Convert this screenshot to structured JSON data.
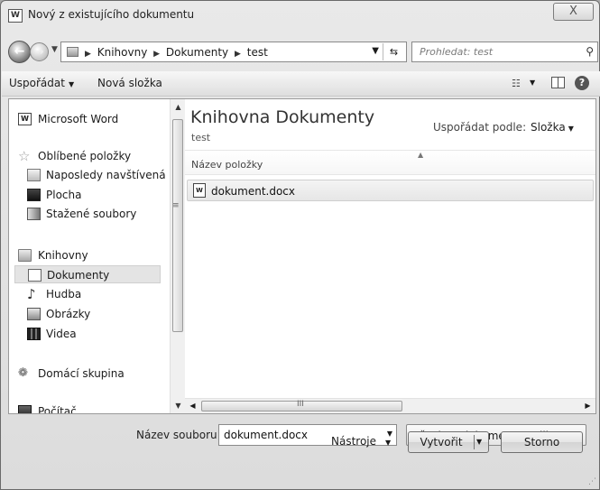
{
  "window": {
    "title": "Nový z existujícího dokumentu",
    "close_label": "X",
    "app_icon_letter": "W"
  },
  "address": {
    "crumbs": [
      "Knihovny",
      "Dokumenty",
      "test"
    ],
    "search_placeholder": "Prohledat: test"
  },
  "toolbar": {
    "organize_label": "Uspořádat",
    "new_folder_label": "Nová složka",
    "help_label": "?"
  },
  "nav": {
    "items": [
      {
        "label": "Microsoft Word",
        "icon": "word-icon"
      },
      {
        "label": "Oblíbené položky",
        "icon": "star-icon"
      },
      {
        "label": "Naposledy navštívená místa",
        "icon": "recent-places-icon"
      },
      {
        "label": "Plocha",
        "icon": "desktop-icon"
      },
      {
        "label": "Stažené soubory",
        "icon": "downloads-icon"
      },
      {
        "label": "Knihovny",
        "icon": "libraries-icon"
      },
      {
        "label": "Dokumenty",
        "icon": "documents-icon",
        "selected": true
      },
      {
        "label": "Hudba",
        "icon": "music-icon"
      },
      {
        "label": "Obrázky",
        "icon": "pictures-icon"
      },
      {
        "label": "Videa",
        "icon": "videos-icon"
      },
      {
        "label": "Domácí skupina",
        "icon": "homegroup-icon"
      },
      {
        "label": "Počítač",
        "icon": "computer-icon"
      }
    ]
  },
  "main": {
    "library_title": "Knihovna Dokumenty",
    "library_subtitle": "test",
    "arrange_label": "Uspořádat podle:",
    "arrange_value": "Složka",
    "column_name": "Název položky",
    "files": [
      {
        "name": "dokument.docx",
        "icon": "word-document-icon"
      }
    ]
  },
  "footer": {
    "filename_label": "Název souboru:",
    "filename_value": "dokument.docx",
    "filetype_value": "Všechny dokumenty aplikace Word",
    "tools_label": "Nástroje",
    "create_label": "Vytvořit",
    "cancel_label": "Storno"
  },
  "scroll": {
    "horizontal_grip": "III"
  }
}
